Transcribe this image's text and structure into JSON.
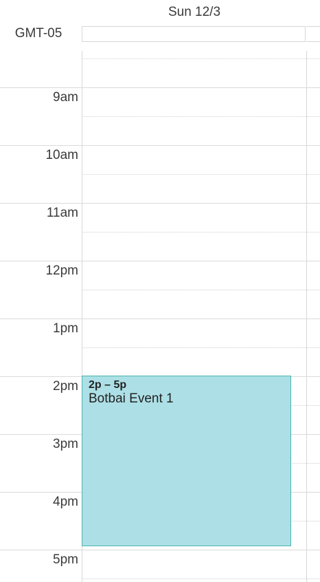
{
  "header": {
    "day_label": "Sun 12/3",
    "timezone": "GMT-05"
  },
  "time_slots": [
    "9am",
    "10am",
    "11am",
    "12pm",
    "1pm",
    "2pm",
    "3pm",
    "4pm",
    "5pm"
  ],
  "event": {
    "time_range": "2p – 5p",
    "title": "Botbai Event 1"
  },
  "colors": {
    "event_fill": "#ade0e6",
    "event_border": "#4ab3ad",
    "grid_line": "#dadada"
  }
}
